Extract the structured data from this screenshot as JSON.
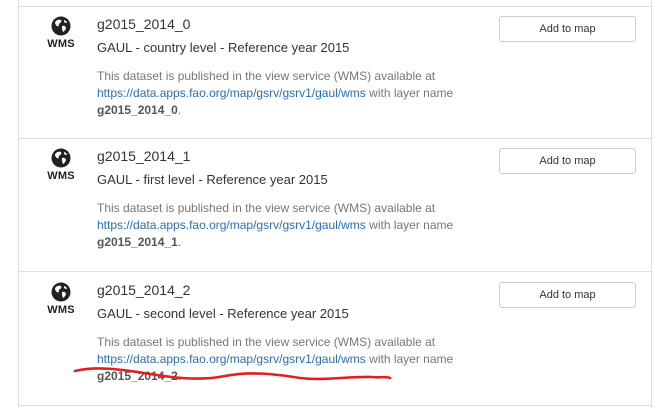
{
  "datasets": [
    {
      "badge": "WMS",
      "name": "g2015_2014_0",
      "subtitle": "GAUL - country level - Reference year 2015",
      "desc_prefix": "This dataset is published in the view service (WMS) available at",
      "url": "https://data.apps.fao.org/map/gsrv/gsrv1/gaul/wms",
      "desc_mid": " with layer name",
      "layer": "g2015_2014_0",
      "desc_suffix": ".",
      "button": "Add to map"
    },
    {
      "badge": "WMS",
      "name": "g2015_2014_1",
      "subtitle": "GAUL - first level - Reference year 2015",
      "desc_prefix": "This dataset is published in the view service (WMS) available at",
      "url": "https://data.apps.fao.org/map/gsrv/gsrv1/gaul/wms",
      "desc_mid": " with layer name",
      "layer": "g2015_2014_1",
      "desc_suffix": ".",
      "button": "Add to map"
    },
    {
      "badge": "WMS",
      "name": "g2015_2014_2",
      "subtitle": "GAUL - second level - Reference year 2015",
      "desc_prefix": "This dataset is published in the view service (WMS) available at",
      "url": "https://data.apps.fao.org/map/gsrv/gsrv1/gaul/wms",
      "desc_mid": " with layer name",
      "layer": "g2015_2014_2",
      "desc_suffix": ".",
      "button": "Add to map"
    }
  ],
  "colors": {
    "link": "#2a6fb3",
    "annotation": "#e02020"
  },
  "icons": {
    "service": "globe-icon"
  }
}
